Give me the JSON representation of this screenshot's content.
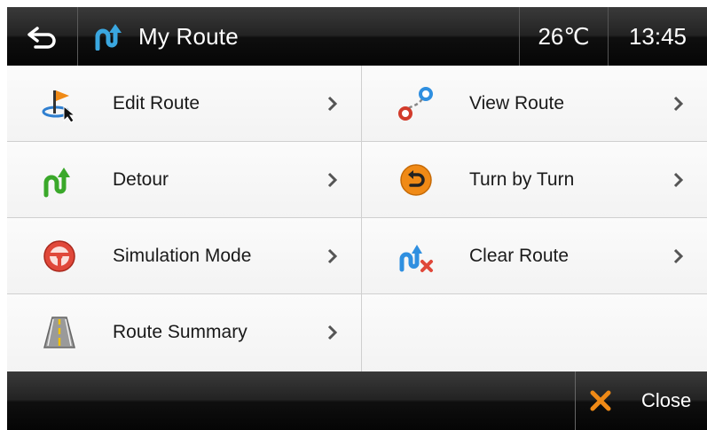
{
  "header": {
    "back_icon": "back-arrow-icon",
    "title_icon": "route-icon",
    "title": "My Route",
    "temperature": "26℃",
    "time": "13:45"
  },
  "menu": {
    "items": [
      {
        "label": "Edit Route",
        "icon": "edit-route-flag-icon"
      },
      {
        "label": "View Route",
        "icon": "view-route-icon"
      },
      {
        "label": "Detour",
        "icon": "detour-icon"
      },
      {
        "label": "Turn by Turn",
        "icon": "turn-by-turn-icon"
      },
      {
        "label": "Simulation Mode",
        "icon": "steering-wheel-icon"
      },
      {
        "label": "Clear Route",
        "icon": "clear-route-icon"
      },
      {
        "label": "Route Summary",
        "icon": "road-icon"
      }
    ]
  },
  "footer": {
    "close_label": "Close",
    "close_icon": "close-x-icon"
  },
  "colors": {
    "bar_dark": "#050505",
    "route_blue": "#3aa7e0",
    "detour_green": "#3aa82a",
    "accent_orange": "#f08a16"
  }
}
